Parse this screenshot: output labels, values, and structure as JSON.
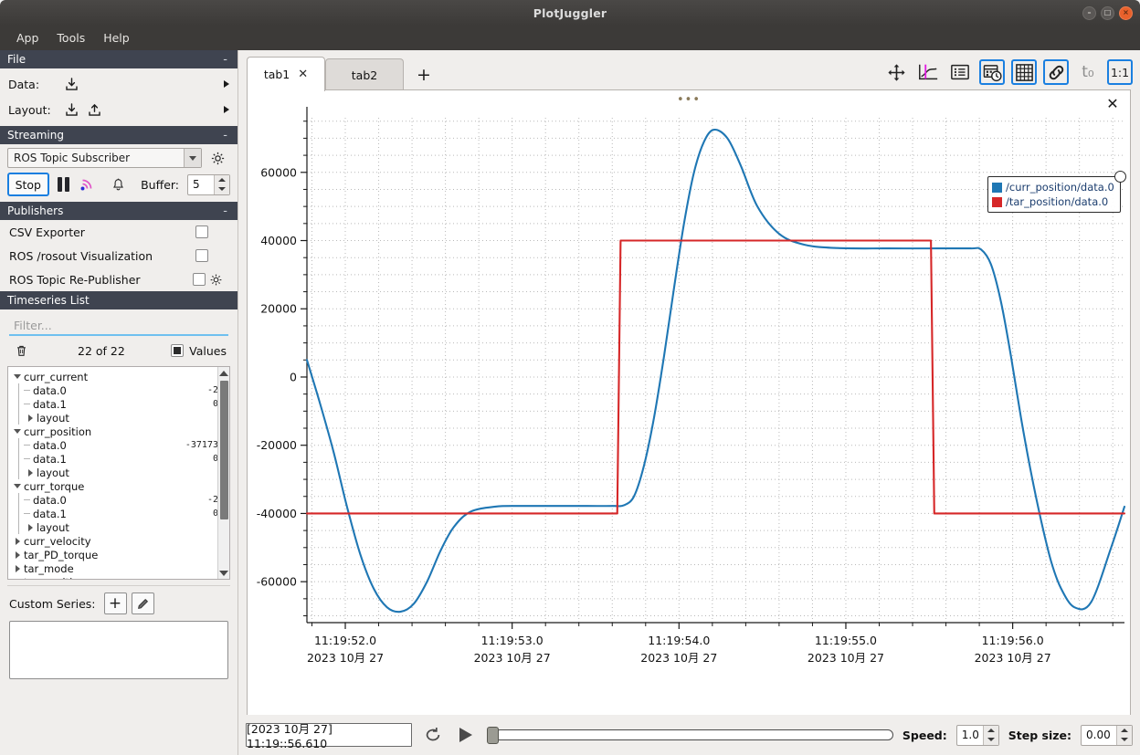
{
  "window": {
    "title": "PlotJuggler",
    "buttons": {
      "minimize": "–",
      "maximize": "□",
      "close": "×"
    }
  },
  "menubar": {
    "items": [
      "App",
      "Tools",
      "Help"
    ]
  },
  "sidebar": {
    "file": {
      "header": "File",
      "collapse": "-",
      "data_label": "Data:",
      "layout_label": "Layout:"
    },
    "streaming": {
      "header": "Streaming",
      "collapse": "-",
      "source": "ROS Topic Subscriber",
      "stop_label": "Stop",
      "buffer_label": "Buffer:",
      "buffer_value": "5"
    },
    "publishers": {
      "header": "Publishers",
      "collapse": "-",
      "items": [
        {
          "label": "CSV Exporter",
          "checked": false,
          "has_gear": false
        },
        {
          "label": "ROS /rosout Visualization",
          "checked": false,
          "has_gear": false
        },
        {
          "label": "ROS Topic Re-Publisher",
          "checked": false,
          "has_gear": true
        }
      ]
    },
    "timeseries": {
      "header": "Timeseries List",
      "filter_placeholder": "Filter...",
      "filter_value": "",
      "count_text": "22 of 22",
      "values_label": "Values",
      "tree": [
        {
          "level": 0,
          "expander": "down",
          "label": "curr_current",
          "value": ""
        },
        {
          "level": 1,
          "expander": "none",
          "label": "data.0",
          "value": "-2"
        },
        {
          "level": 1,
          "expander": "none",
          "label": "data.1",
          "value": "0"
        },
        {
          "level": 1,
          "expander": "right",
          "label": "layout",
          "value": ""
        },
        {
          "level": 0,
          "expander": "down",
          "label": "curr_position",
          "value": ""
        },
        {
          "level": 1,
          "expander": "none",
          "label": "data.0",
          "value": "-37173"
        },
        {
          "level": 1,
          "expander": "none",
          "label": "data.1",
          "value": "0"
        },
        {
          "level": 1,
          "expander": "right",
          "label": "layout",
          "value": ""
        },
        {
          "level": 0,
          "expander": "down",
          "label": "curr_torque",
          "value": ""
        },
        {
          "level": 1,
          "expander": "none",
          "label": "data.0",
          "value": "-2"
        },
        {
          "level": 1,
          "expander": "none",
          "label": "data.1",
          "value": "0"
        },
        {
          "level": 1,
          "expander": "right",
          "label": "layout",
          "value": ""
        },
        {
          "level": 0,
          "expander": "right",
          "label": "curr_velocity",
          "value": ""
        },
        {
          "level": 0,
          "expander": "right",
          "label": "tar_PD_torque",
          "value": ""
        },
        {
          "level": 0,
          "expander": "right",
          "label": "tar_mode",
          "value": ""
        },
        {
          "level": 0,
          "expander": "right",
          "label": "tar_position",
          "value": ""
        }
      ]
    },
    "custom_series": {
      "label": "Custom Series:",
      "add": "+",
      "edit": "✎"
    }
  },
  "tabs": {
    "items": [
      {
        "label": "tab1",
        "active": true,
        "closable": true,
        "close": "✕"
      },
      {
        "label": "tab2",
        "active": false,
        "closable": false,
        "close": ""
      }
    ],
    "add_label": "+"
  },
  "toolbar": {
    "buttons": [
      {
        "name": "pan-move-icon",
        "label": "",
        "active": false
      },
      {
        "name": "plot-cursor-icon",
        "label": "",
        "active": false
      },
      {
        "name": "list-icon",
        "label": "",
        "active": false
      },
      {
        "name": "datetime-icon",
        "label": "",
        "active": true
      },
      {
        "name": "grid-icon",
        "label": "",
        "active": true
      },
      {
        "name": "link-icon",
        "label": "",
        "active": true
      },
      {
        "name": "t-zero-icon",
        "label": "t₀",
        "active": false
      },
      {
        "name": "one-to-one-icon",
        "label": "1:1",
        "active": true
      }
    ]
  },
  "plot": {
    "drag_handle": "•••",
    "close": "✕",
    "legend": [
      {
        "label": "/curr_position/data.0",
        "color": "#1f77b4"
      },
      {
        "label": "/tar_position/data.0",
        "color": "#d62728"
      }
    ]
  },
  "chart_data": {
    "type": "line",
    "title": "",
    "xlabel": "",
    "ylabel": "",
    "grid": true,
    "legend_position": "top-right",
    "xtick_labels": [
      {
        "time": "11:19:52.0",
        "date": "2023 10月 27"
      },
      {
        "time": "11:19:53.0",
        "date": "2023 10月 27"
      },
      {
        "time": "11:19:54.0",
        "date": "2023 10月 27"
      },
      {
        "time": "11:19:55.0",
        "date": "2023 10月 27"
      },
      {
        "time": "11:19:56.0",
        "date": "2023 10月 27"
      }
    ],
    "ytick_labels": [
      "60000",
      "40000",
      "20000",
      "0",
      "-20000",
      "-40000",
      "-60000"
    ],
    "xlim": [
      51.72,
      56.62
    ],
    "ylim": [
      -72000,
      76000
    ],
    "series": [
      {
        "name": "/curr_position/data.0",
        "color": "#1f77b4",
        "x": [
          51.72,
          51.8,
          51.88,
          51.96,
          52.04,
          52.12,
          52.2,
          52.28,
          52.36,
          52.44,
          52.52,
          52.6,
          52.7,
          52.85,
          53.0,
          53.2,
          53.4,
          53.56,
          53.62,
          53.68,
          53.74,
          53.8,
          53.86,
          53.92,
          53.98,
          54.04,
          54.1,
          54.16,
          54.24,
          54.32,
          54.42,
          54.55,
          54.7,
          54.9,
          55.2,
          55.5,
          55.7,
          55.76,
          55.82,
          55.88,
          55.94,
          56.0,
          56.06,
          56.12,
          56.18,
          56.24,
          56.32,
          56.42,
          56.54,
          56.62
        ],
        "y": [
          5000,
          -8000,
          -22000,
          -38000,
          -52000,
          -62000,
          -67500,
          -68800,
          -66500,
          -60000,
          -51000,
          -44000,
          -39500,
          -38000,
          -37800,
          -37800,
          -37800,
          -37800,
          -37600,
          -35000,
          -26000,
          -12000,
          6000,
          26000,
          45000,
          60000,
          69000,
          72500,
          70000,
          62000,
          50000,
          42000,
          38800,
          37800,
          37700,
          37700,
          37700,
          37400,
          33000,
          22000,
          6000,
          -12000,
          -28000,
          -42000,
          -54000,
          -62000,
          -67500,
          -66000,
          -50000,
          -38000
        ]
      },
      {
        "name": "/tar_position/data.0",
        "color": "#d62728",
        "x": [
          51.72,
          53.58,
          53.6,
          55.46,
          55.48,
          56.62
        ],
        "y": [
          -40000,
          -40000,
          40000,
          40000,
          -40000,
          -40000
        ]
      }
    ]
  },
  "playback": {
    "timestamp": "[2023 10月 27] 11:19::56.610",
    "loop_icon": "loop",
    "play_icon": "play",
    "slider_value": 0,
    "speed_label": "Speed:",
    "speed_value": "1.0",
    "step_label": "Step size:",
    "step_value": "0.00"
  }
}
